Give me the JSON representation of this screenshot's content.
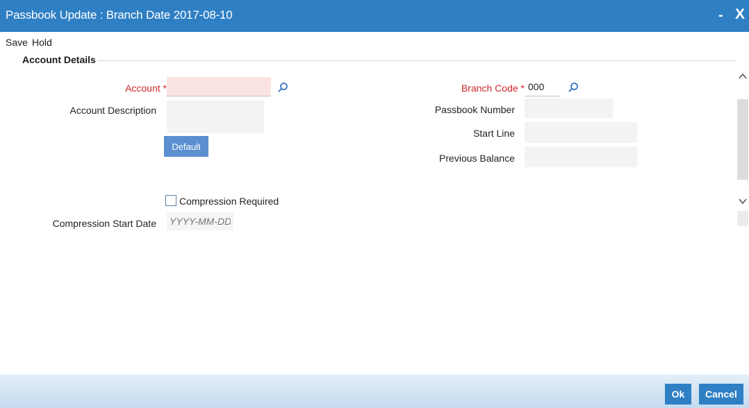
{
  "window": {
    "title": "Passbook Update : Branch Date 2017-08-10",
    "minimize_glyph": "-",
    "close_glyph": "X"
  },
  "toolbar": {
    "save_label": "Save",
    "hold_label": "Hold"
  },
  "section": {
    "title": "Account Details"
  },
  "fields": {
    "account_label": "Account",
    "account_value": "",
    "account_description_label": "Account Description",
    "account_description_value": "",
    "default_button": "Default",
    "compression_required_label": "Compression Required",
    "compression_required_checked": false,
    "compression_start_date_label": "Compression Start Date",
    "compression_start_date_placeholder": "YYYY-MM-DD",
    "branch_code_label": "Branch Code",
    "branch_code_value": "000",
    "passbook_number_label": "Passbook Number",
    "passbook_number_value": "",
    "start_line_label": "Start Line",
    "start_line_value": "",
    "previous_balance_label": "Previous Balance",
    "previous_balance_value": "",
    "required_marker": "*"
  },
  "footer": {
    "ok_label": "Ok",
    "cancel_label": "Cancel"
  },
  "icons": {
    "lookup": "search-icon",
    "scroll_up": "chevron-up-icon",
    "scroll_down": "chevron-down-icon"
  },
  "colors": {
    "titlebar": "#2f7fc4",
    "required_label": "#d0262b",
    "mandatory_field_bg": "#fbe3e3",
    "button_bg": "#5b8fd0",
    "footer_button_bg": "#2f7fc4"
  }
}
